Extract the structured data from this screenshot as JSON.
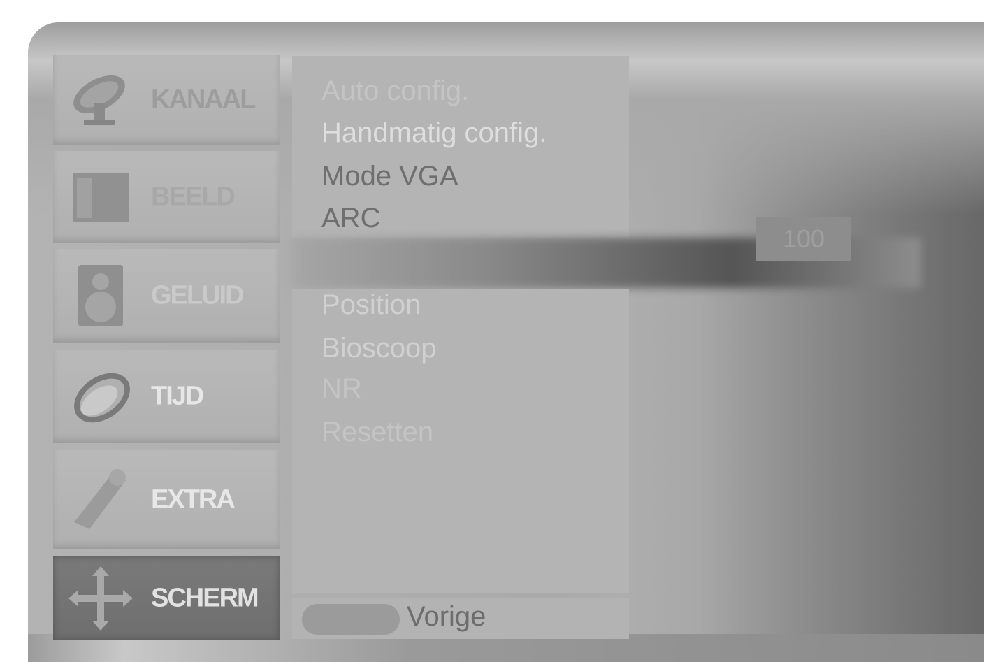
{
  "categories": [
    {
      "label": "KANAAL",
      "icon": "satellite-dish-icon"
    },
    {
      "label": "BEELD",
      "icon": "screen-icon"
    },
    {
      "label": "GELUID",
      "icon": "speaker-icon"
    },
    {
      "label": "TIJD",
      "icon": "clock-icon"
    },
    {
      "label": "EXTRA",
      "icon": "tool-icon"
    },
    {
      "label": "SCHERM",
      "icon": "move-arrows-icon"
    }
  ],
  "active_category": "SCHERM",
  "submenu_top": [
    "Auto config.",
    "Handmatig config.",
    "Mode VGA",
    "ARC"
  ],
  "submenu_bottom": [
    "Position",
    "Bioscoop",
    "NR",
    "Resetten"
  ],
  "value": "100",
  "footer": {
    "back_label": "Vorige"
  }
}
